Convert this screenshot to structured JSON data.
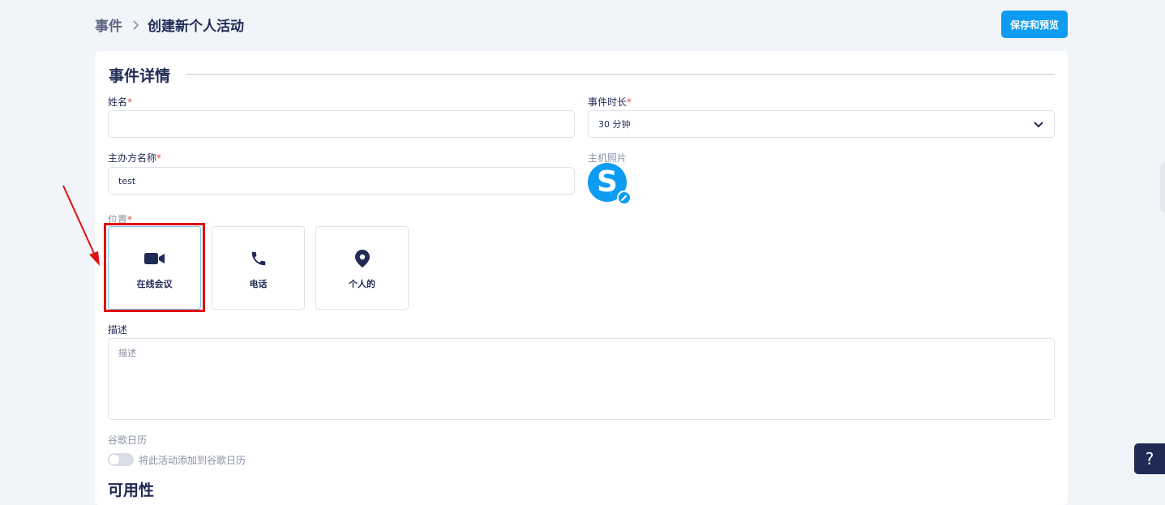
{
  "breadcrumb": {
    "root": "事件",
    "current": "创建新个人活动"
  },
  "header": {
    "save_label": "保存和预览"
  },
  "event_details": {
    "title": "事件详情",
    "name": {
      "label": "姓名",
      "required": "*",
      "value": ""
    },
    "duration": {
      "label": "事件时长",
      "required": "*",
      "selected": "30 分钟"
    },
    "host_name": {
      "label": "主办方名称",
      "required": "*",
      "value": "test"
    },
    "host_photo": {
      "label": "主机照片",
      "avatar_letter": "S"
    },
    "location": {
      "label": "位置",
      "required": "*",
      "options": [
        {
          "label": "在线会议",
          "icon": "video-camera-icon",
          "selected": true
        },
        {
          "label": "电话",
          "icon": "phone-icon",
          "selected": false
        },
        {
          "label": "个人的",
          "icon": "map-pin-icon",
          "selected": false
        }
      ]
    },
    "description": {
      "label": "描述",
      "placeholder": "描述"
    },
    "google_calendar": {
      "label": "谷歌日历",
      "toggle_label": "将此活动添加到谷歌日历",
      "enabled": false
    }
  },
  "availability": {
    "title": "可用性"
  },
  "help": {
    "label": "?"
  },
  "colors": {
    "accent": "#0d9cf1",
    "text": "#1f2a55",
    "annotation": "#e01010"
  }
}
